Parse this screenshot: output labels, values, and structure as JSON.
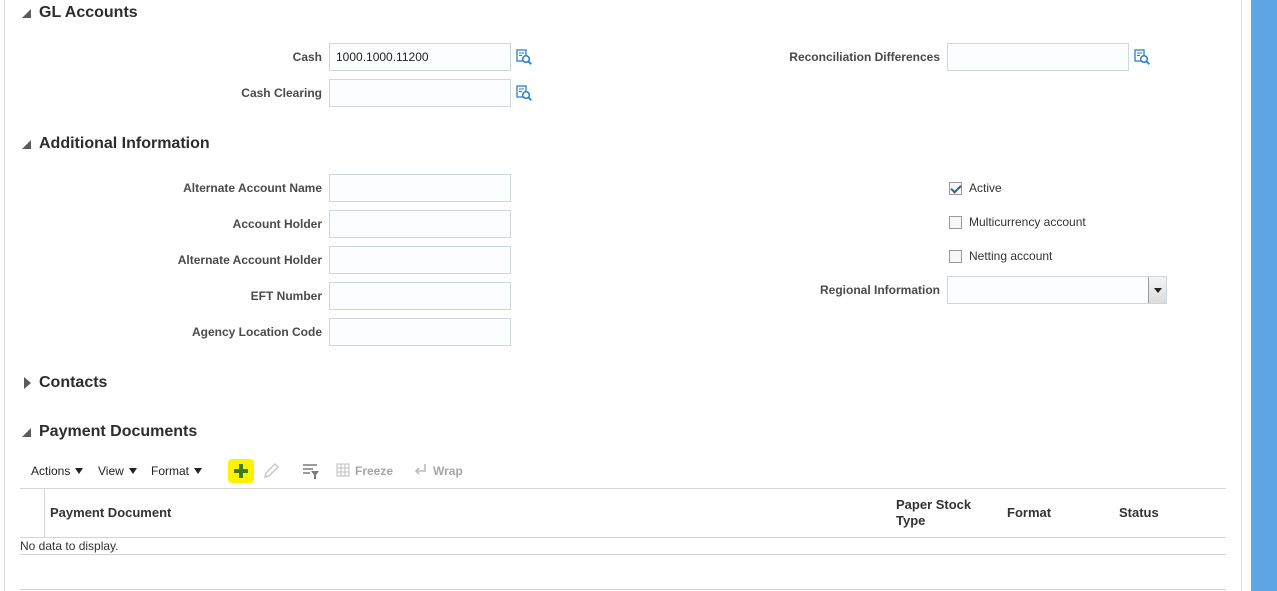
{
  "gl_accounts": {
    "title": "GL Accounts",
    "cash_label": "Cash",
    "cash_value": "1000.1000.11200",
    "cash_clearing_label": "Cash Clearing",
    "cash_clearing_value": "",
    "reconciliation_label": "Reconciliation Differences",
    "reconciliation_value": ""
  },
  "additional_info": {
    "title": "Additional Information",
    "alternate_account_name_label": "Alternate Account Name",
    "account_holder_label": "Account Holder",
    "alternate_account_holder_label": "Alternate Account Holder",
    "eft_number_label": "EFT Number",
    "agency_location_code_label": "Agency Location Code",
    "active_label": "Active",
    "active_checked": true,
    "multicurrency_label": "Multicurrency account",
    "multicurrency_checked": false,
    "netting_label": "Netting account",
    "netting_checked": false,
    "regional_info_label": "Regional Information",
    "regional_info_value": ""
  },
  "contacts": {
    "title": "Contacts"
  },
  "payment_documents": {
    "title": "Payment Documents",
    "toolbar": {
      "actions": "Actions",
      "view": "View",
      "format": "Format",
      "freeze": "Freeze",
      "wrap": "Wrap"
    },
    "columns": {
      "payment_document": "Payment Document",
      "paper_stock_type": "Paper Stock Type",
      "format": "Format",
      "status": "Status"
    },
    "empty_message": "No data to display."
  },
  "colors": {
    "accent_blue": "#5ca6e6",
    "highlight_yellow": "#fff200",
    "add_green": "#3b7a1f",
    "lookup_blue": "#2a7fc9"
  },
  "icons": [
    "lookup-icon",
    "add-icon",
    "edit-icon",
    "query-by-example-icon",
    "freeze-icon",
    "wrap-icon"
  ]
}
